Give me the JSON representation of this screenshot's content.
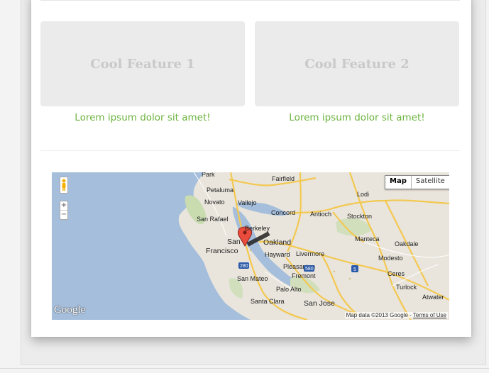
{
  "features": [
    {
      "title": "Cool Feature 1",
      "link": "Lorem ipsum dolor sit amet!"
    },
    {
      "title": "Cool Feature 2",
      "link": "Lorem ipsum dolor sit amet!"
    }
  ],
  "map": {
    "type_buttons": {
      "map": "Map",
      "satellite": "Satellite"
    },
    "zoom": {
      "in": "+",
      "out": "−"
    },
    "logo": "Google",
    "attribution": "Map data ©2013 Google",
    "terms": "Terms of Use",
    "cities": {
      "park": "Park",
      "fairfield": "Fairfield",
      "petaluma": "Petaluma",
      "lodi": "Lodi",
      "novato": "Novato",
      "vallejo": "Vallejo",
      "concord": "Concord",
      "antioch": "Antioch",
      "stockton": "Stockton",
      "san_rafael": "San Rafael",
      "berkeley": "Berkeley",
      "san": "San",
      "francisco": "Francisco",
      "oakland": "Oakland",
      "manteca": "Manteca",
      "hayward": "Hayward",
      "livermore": "Livermore",
      "modesto": "Modesto",
      "oakdale": "Oakdale",
      "pleasanton": "Pleasanton",
      "ceres": "Ceres",
      "san_mateo": "San Mateo",
      "fremont": "Fremont",
      "turlock": "Turlock",
      "palo_alto": "Palo Alto",
      "atwater": "Atwater",
      "santa_clara": "Santa Clara",
      "san_jose": "San Jose"
    },
    "shields": {
      "i280": "280",
      "i580": "580",
      "i5": "5"
    }
  }
}
